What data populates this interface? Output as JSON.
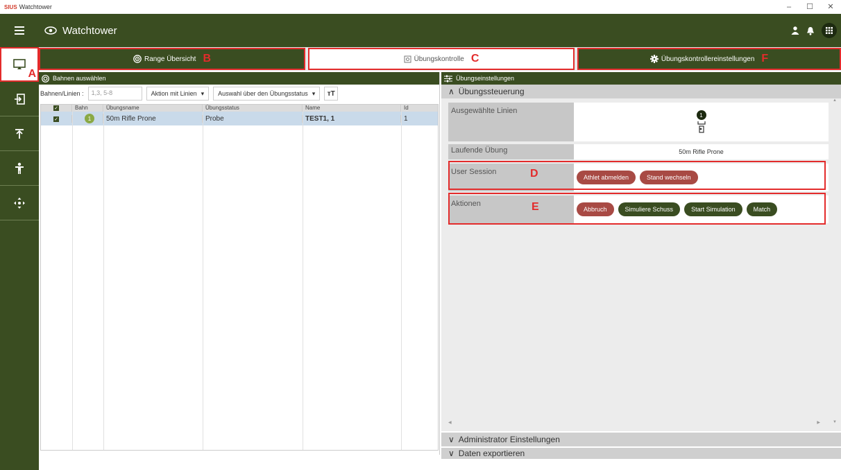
{
  "window": {
    "logo": "SIUS",
    "title": "Watchtower"
  },
  "appbar": {
    "title": "Watchtower"
  },
  "rail": {
    "marker": "A"
  },
  "tabs": [
    {
      "label": "Range Übersicht",
      "marker": "B"
    },
    {
      "label": "Übungskontrolle",
      "marker": "C"
    },
    {
      "label": "Übungskontrollereinstellungen",
      "marker": "F"
    }
  ],
  "left": {
    "header": "Bahnen auswählen",
    "filter_label": "Bahnen/Linien :",
    "filter_placeholder": "1,3, 5-8",
    "dropdown1": "Aktion mit Linien",
    "dropdown2": "Auswahl über den Übungsstatus",
    "text_btn": "ᴛT",
    "columns": [
      "",
      "Bahn",
      "Übungsname",
      "Übungsstatus",
      "Name",
      "Id"
    ],
    "rows": [
      {
        "bahn": "1",
        "uebungsname": "50m Rifle Prone",
        "status": "Probe",
        "name": "TEST1, 1",
        "id": "1"
      }
    ]
  },
  "right": {
    "header": "Übungseinstellungen",
    "section": "Übungssteuerung",
    "selected_label": "Ausgewählte Linien",
    "selected_badge": "1",
    "running_label": "Laufende Übung",
    "running_value": "50m Rifle Prone",
    "session_label": "User Session",
    "session_marker": "D",
    "session_buttons": [
      "Athlet abmelden",
      "Stand wechseln"
    ],
    "actions_label": "Aktionen",
    "actions_marker": "E",
    "action_buttons": [
      {
        "label": "Abbruch",
        "color": "#a84a44"
      },
      {
        "label": "Simuliere Schuss",
        "color": "#3a4d21"
      },
      {
        "label": "Start Simulation",
        "color": "#3a4d21"
      },
      {
        "label": "Match",
        "color": "#3a4d21"
      }
    ],
    "admin_section": "Administrator Einstellungen",
    "export_section": "Daten exportieren"
  },
  "colors": {
    "brand": "#3a4d21",
    "highlight": "#e32b2b",
    "selected_row": "#c9daea"
  }
}
